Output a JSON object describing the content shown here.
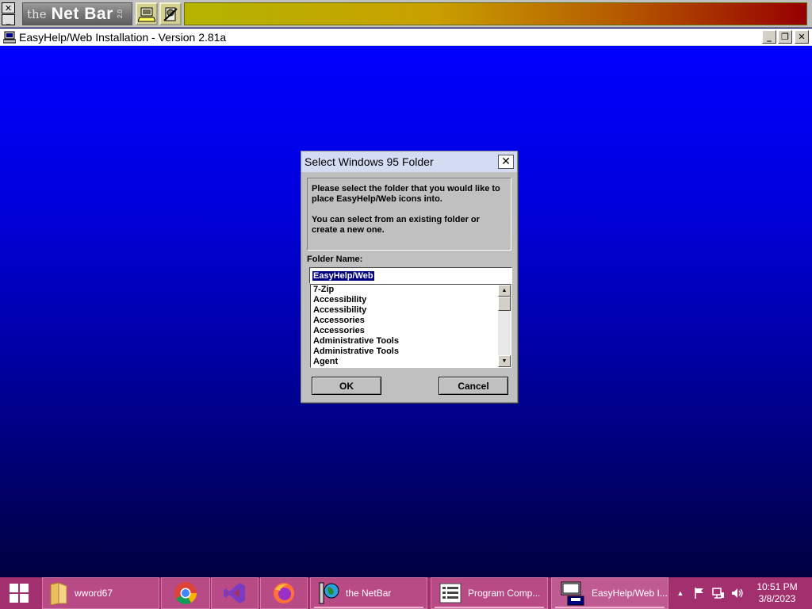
{
  "netbar": {
    "close_glyph": "✕",
    "minimize_glyph": "_",
    "logo_the": "the",
    "logo_name": "Net Bar",
    "logo_version": "2.0",
    "tool_icons": [
      "computer-icon",
      "tools-icon"
    ]
  },
  "window": {
    "title": "EasyHelp/Web Installation - Version 2.81a",
    "minimize_glyph": "_",
    "restore_glyph": "❐",
    "close_glyph": "✕"
  },
  "dialog": {
    "title": "Select Windows 95 Folder",
    "close_glyph": "✕",
    "info_line1": "Please select the folder that you would like to place EasyHelp/Web icons into.",
    "info_line2": "You can select from an existing folder or create a new one.",
    "folder_label": "Folder Name:",
    "folder_value": "EasyHelp/Web",
    "folder_items": [
      "7-Zip",
      "Accessibility",
      "Accessibility",
      "Accessories",
      "Accessories",
      "Administrative Tools",
      "Administrative Tools",
      "Agent"
    ],
    "scroll_up_glyph": "▲",
    "scroll_down_glyph": "▼",
    "ok_label": "OK",
    "cancel_label": "Cancel"
  },
  "taskbar": {
    "pinned_label": "wword67",
    "netbar_label": "the NetBar",
    "program_label": "Program Comp...",
    "easyhelp_label": "EasyHelp/Web I...",
    "tray_chevron": "▲",
    "clock_time": "10:51 PM",
    "clock_date": "3/8/2023",
    "colors": {
      "taskbar": "#a3306e",
      "desktop_top": "#0000ff",
      "desktop_bottom": "#000040"
    }
  }
}
